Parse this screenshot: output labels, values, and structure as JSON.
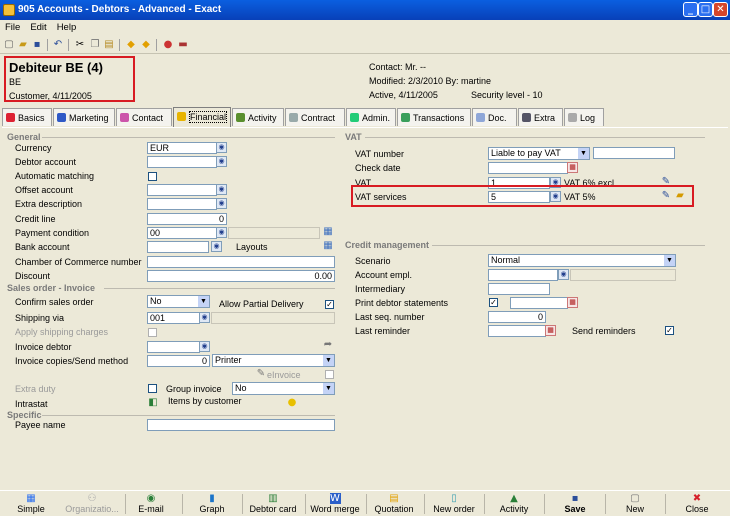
{
  "window": {
    "title": "905 Accounts - Debtors - Advanced - Exact",
    "min": "_",
    "max": "□",
    "close": "✕"
  },
  "menu": {
    "file": "File",
    "edit": "Edit",
    "help": "Help"
  },
  "header": {
    "title": "Debiteur BE (4)",
    "code": "BE",
    "type_date": "Customer, 4/11/2005",
    "contact": "Contact: Mr. --",
    "modified": "Modified: 2/3/2010  By: martine",
    "active": "Active, 4/11/2005",
    "security": "Security level - 10"
  },
  "tabs": [
    "Basics",
    "Marketing",
    "Contact",
    "Financial",
    "Activity",
    "Contract",
    "Admin.",
    "Transactions",
    "Doc.",
    "Extra",
    "Log"
  ],
  "general": {
    "section": "General",
    "currency_label": "Currency",
    "currency": "EUR",
    "debtor_account_label": "Debtor account",
    "auto_matching_label": "Automatic matching",
    "offset_account_label": "Offset account",
    "extra_description_label": "Extra description",
    "credit_line_label": "Credit line",
    "credit_line": "0",
    "payment_condition_label": "Payment condition",
    "payment_condition": "00",
    "bank_account_label": "Bank account",
    "layouts": "Layouts",
    "coc_label": "Chamber of Commerce number",
    "discount_label": "Discount",
    "discount": "0.00"
  },
  "sales": {
    "section": "Sales order - Invoice",
    "confirm_label": "Confirm sales order",
    "confirm": "No",
    "allow_partial": "Allow Partial Delivery",
    "shipping_via_label": "Shipping via",
    "shipping_via": "001",
    "apply_shipping_label": "Apply shipping charges",
    "invoice_debtor_label": "Invoice debtor",
    "invoice_copies_label": "Invoice copies/Send method",
    "invoice_copies": "0",
    "send_method": "Printer",
    "einvoice": "eInvoice",
    "extra_duty_label": "Extra duty",
    "group_invoice": "Group invoice",
    "group_invoice_value": "No",
    "intrastat_label": "Intrastat",
    "items_by_customer": "Items by customer"
  },
  "specific": {
    "section": "Specific",
    "payee_label": "Payee name"
  },
  "vat": {
    "section": "VAT",
    "vat_number_label": "VAT number",
    "vat_number": "Liable to pay VAT",
    "check_date_label": "Check date",
    "vat_label": "VAT",
    "vat_code": "1",
    "vat_desc": "VAT 6% excl.",
    "vat_services_label": "VAT services",
    "vat_services_code": "5",
    "vat_services_desc": "VAT 5%"
  },
  "credit": {
    "section": "Credit management",
    "scenario_label": "Scenario",
    "scenario": "Normal",
    "account_empl_label": "Account empl.",
    "intermediary_label": "Intermediary",
    "print_statements_label": "Print debtor statements",
    "last_seq_label": "Last seq. number",
    "last_seq": "0",
    "last_reminder_label": "Last reminder",
    "send_reminders": "Send reminders"
  },
  "bottom": [
    "Simple",
    "Organizatio...",
    "E-mail",
    "Graph",
    "Debtor card",
    "Word merge",
    "Quotation",
    "New order",
    "Activity",
    "Save",
    "New",
    "Close"
  ]
}
